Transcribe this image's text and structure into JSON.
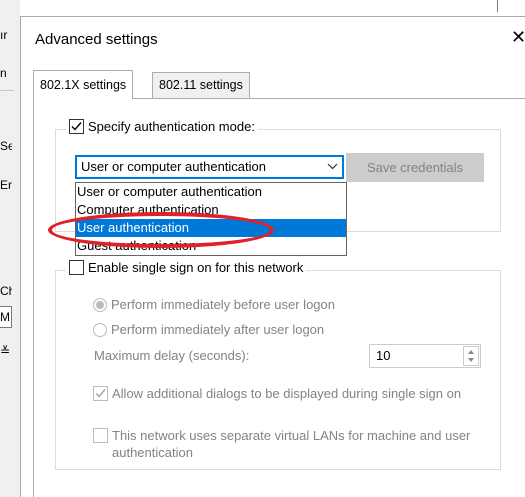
{
  "background_window": {
    "fragments": [
      "ır",
      "n",
      "Se",
      "Er",
      "Ch",
      "M",
      "≚"
    ]
  },
  "dialog": {
    "title": "Advanced settings",
    "close_glyph": "✕"
  },
  "tabs": [
    {
      "label": "802.1X settings",
      "active": true
    },
    {
      "label": "802.11 settings",
      "active": false
    }
  ],
  "auth": {
    "checkbox_label": "Specify authentication mode:",
    "checked": true,
    "selected_value": "User or computer authentication",
    "save_credentials_label": "Save credentials",
    "options": [
      "User or computer authentication",
      "Computer authentication",
      "User authentication",
      "Guest authentication"
    ],
    "highlighted_option": "User authentication"
  },
  "sso": {
    "checkbox_label": "Enable single sign on for this network",
    "checked": false,
    "radio_before": "Perform immediately before user logon",
    "radio_after": "Perform immediately after user logon",
    "delay_label": "Maximum delay (seconds):",
    "delay_value": "10",
    "allow_dialogs_label": "Allow additional dialogs to be displayed during single sign on",
    "allow_dialogs_checked": true,
    "vlan_label": "This network uses separate virtual LANs for machine and user authentication",
    "vlan_checked": false
  },
  "colors": {
    "selection": "#0078d7",
    "annotation": "#e0202a",
    "disabled_text": "#838383"
  }
}
